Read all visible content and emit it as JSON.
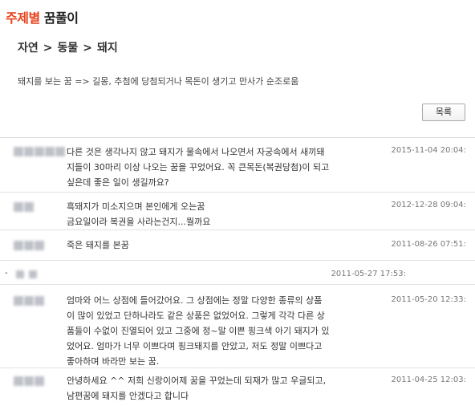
{
  "header": {
    "title_accent": "주제별",
    "title_main": "꿈풀이"
  },
  "breadcrumb": {
    "items": [
      "자연",
      "동물",
      "돼지"
    ],
    "separator": ">"
  },
  "description": "돼지를 보는 꿈 => 길몽, 추첨에 당첨되거나 목돈이 생기고 만사가 순조로움",
  "list_button_label": "목록",
  "comments": [
    {
      "content": "다른 것은 생각나지 않고 돼지가 물속에서 나오면서 자궁속에서 새끼돼\n지들이 30마리 이상 나오는 꿈을 꾸었어요. 꼭 큰목돈(복권당첨)이 되고\n싶은데 좋은 일이 생길까요?",
      "date": "2015-11-04 20:04:"
    },
    {
      "content": "흑돼지가 미소지으며 본인에게 오는꿈\n금요일이라 복권을 사라는건지...뭘까요",
      "date": "2012-12-28 09:04:"
    },
    {
      "content": "죽은 돼지를 본꿈",
      "date": "2011-08-26 07:51:"
    },
    {
      "dash": "-",
      "content": "",
      "date": "2011-05-27 17:53:"
    },
    {
      "content": "엄마와 어느 상점에 들어갔어요. 그 상점에는 정말 다양한 종류의 상품\n이 많이 있었고 단하나라도 같은 상품은 없었어요. 그렇게 각각 다른 상\n품들이 수없이 진열되어 있고 그중에 정~말 이쁜 핑크색 아기 돼지가 있\n었어요. 엄마가 너무 이쁘다며 핑크돼지를 안았고, 저도 정말 이쁘다고\n좋아하며 바라만 보는 꿈.",
      "date": "2011-05-20 12:33:"
    },
    {
      "content": "안녕하세요 ^^ 저희 신랑이어제 꿈을 꾸었는데 되재가 많고 우글되고,\n남편꿈에 돼지를 안겠다고 합니다",
      "date": "2011-04-25 12:03:"
    }
  ]
}
